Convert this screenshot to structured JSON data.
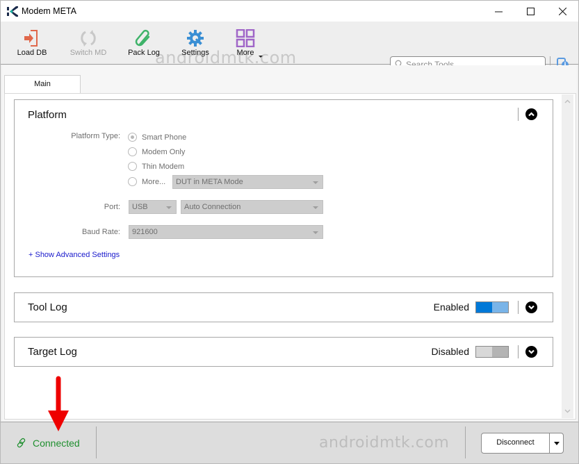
{
  "window": {
    "title": "Modem META"
  },
  "toolbar": {
    "items": [
      {
        "label": "Load DB",
        "icon": "load-db-icon",
        "enabled": true
      },
      {
        "label": "Switch MD",
        "icon": "switch-md-icon",
        "enabled": false
      },
      {
        "label": "Pack Log",
        "icon": "paperclip-icon",
        "enabled": true
      },
      {
        "label": "Settings",
        "icon": "gear-icon",
        "enabled": true
      },
      {
        "label": "More",
        "icon": "grid-icon",
        "enabled": true
      }
    ],
    "watermark": "androidmtk.com",
    "search": {
      "placeholder": "Search Tools",
      "value": ""
    }
  },
  "tabs": [
    {
      "label": "Main",
      "active": true
    }
  ],
  "platform": {
    "title": "Platform",
    "platform_type_label": "Platform Type:",
    "options": [
      {
        "label": "Smart Phone",
        "checked": true
      },
      {
        "label": "Modem Only",
        "checked": false
      },
      {
        "label": "Thin Modem",
        "checked": false
      },
      {
        "label": "More...",
        "checked": false
      }
    ],
    "more_select": "DUT in META Mode",
    "port_label": "Port:",
    "port_select": "USB",
    "connection_select": "Auto Connection",
    "baud_label": "Baud Rate:",
    "baud_select": "921600",
    "advanced_link": "+ Show Advanced Settings"
  },
  "tool_log": {
    "title": "Tool Log",
    "status": "Enabled",
    "enabled": true
  },
  "target_log": {
    "title": "Target Log",
    "status": "Disabled",
    "enabled": false
  },
  "statusbar": {
    "connection_status": "Connected",
    "watermark": "androidmtk.com",
    "disconnect_label": "Disconnect"
  },
  "colors": {
    "connected_green": "#1f8f2f",
    "toggle_on": "#0078d7",
    "link_blue": "#1a1acc",
    "annotation_red": "#ee0000"
  }
}
